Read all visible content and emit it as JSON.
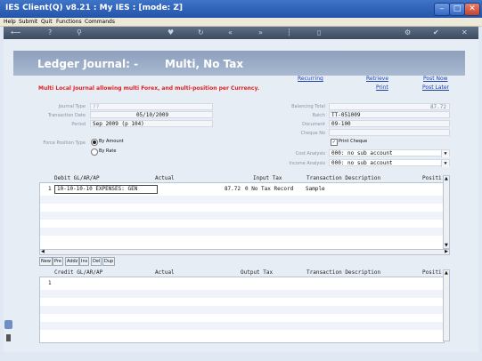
{
  "window": {
    "title": "IES Client(Q) v8.21 : My IES :     [mode: Z]"
  },
  "menu": [
    "Help",
    "Submit",
    "Quit",
    "Functions",
    "Commands"
  ],
  "header": {
    "title": "Ledger Journal: -",
    "subtitle": "Multi, No Tax"
  },
  "links": {
    "recurring": "Recurring",
    "retrieve": "Retrieve",
    "print": "Print",
    "post_now": "Post Now",
    "post_later": "Post Later"
  },
  "info_text": "Multi Local Journal allowing multi Forex, and multi-position per Currency.",
  "form": {
    "journal_type": {
      "label": "Journal Type",
      "value": "??"
    },
    "transaction_date": {
      "label": "Transaction Date",
      "value": "05/10/2009"
    },
    "period": {
      "label": "Period",
      "value": "Sep 2009 (p 104)"
    },
    "posting_type": {
      "label": "Force Position Type",
      "opt1": "By Amount",
      "opt2": "By Rate"
    },
    "balancing_total": {
      "label": "Balancing Total",
      "value": "87.72"
    },
    "batch": {
      "label": "Batch",
      "value": "TT-051009"
    },
    "document": {
      "label": "Document",
      "value": "09-100"
    },
    "cheque_no": {
      "label": "Cheque No",
      "value": ""
    },
    "print_cheque": {
      "label": "Print Cheque"
    },
    "cost_analysis": {
      "label": "Cost Analysis",
      "value": "000: no sub account"
    },
    "income_analysis": {
      "label": "Income Analysis",
      "value": "000: no sub account"
    }
  },
  "debit_grid": {
    "columns": [
      "Debit GL/AR/AP",
      "Actual",
      "Input Tax",
      "Transaction Description",
      "Positi"
    ],
    "rows": [
      {
        "num": "1",
        "account": "10-10-10-10 EXPENSES: GEN",
        "actual": "87.72",
        "tax": "0 No Tax Record",
        "desc": "Sample"
      }
    ]
  },
  "grid_tabs": [
    "New",
    "Pre",
    "Addz",
    "Ins",
    "Del",
    "Dup"
  ],
  "credit_grid": {
    "columns": [
      "Credit GL/AR/AP",
      "Actual",
      "Output Tax",
      "Transaction Description",
      "Positi"
    ],
    "rows": [
      {
        "num": "1"
      }
    ]
  },
  "colors": {
    "title_bar": "#2f63bf",
    "header_band": "#9aacc7",
    "info_text": "#e02020",
    "link": "#1f3fa8"
  }
}
